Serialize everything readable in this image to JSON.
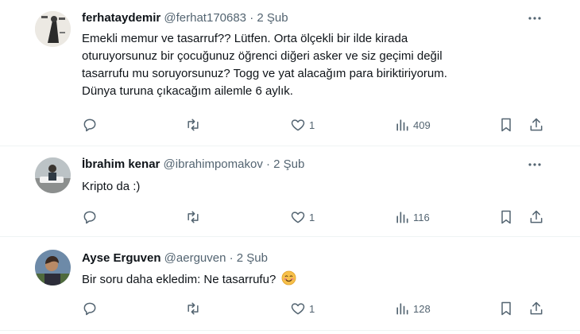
{
  "replies": [
    {
      "name": "ferhataydemir",
      "handle": "@ferhat170683",
      "dot": "·",
      "time": "2 Şub",
      "lines": [
        "Emekli memur ve tasarruf?? Lütfen. Orta ölçekli bir ilde kirada",
        "oturuyorsunuz bir çocuğunuz öğrenci diğeri asker ve siz geçimi değil",
        "tasarrufu mu soruyorsunuz? Togg ve  yat alacağım para biriktiriyorum.",
        "Dünya turuna çıkacağım ailemle 6 aylık."
      ],
      "likes": "1",
      "views": "409"
    },
    {
      "name": "İbrahim kenar",
      "handle": "@ibrahimpomakov",
      "dot": "·",
      "time": "2 Şub",
      "lines": [
        "Kripto da :)"
      ],
      "likes": "1",
      "views": "116"
    },
    {
      "name": "Ayse Erguven",
      "handle": "@aerguven",
      "dot": "·",
      "time": "2 Şub",
      "lines": [
        "Bir soru daha ekledim: Ne tasarrufu?"
      ],
      "emoji": "😊",
      "likes": "1",
      "views": "128"
    }
  ],
  "icons": {
    "reply": "reply-icon",
    "retweet": "retweet-icon",
    "like": "heart-icon",
    "views": "views-icon",
    "bookmark": "bookmark-icon",
    "share": "share-icon",
    "more": "more-icon"
  },
  "colors": {
    "text": "#0f1419",
    "secondary": "#536471",
    "divider": "#eff3f4",
    "emoji": "#f7c04a"
  }
}
